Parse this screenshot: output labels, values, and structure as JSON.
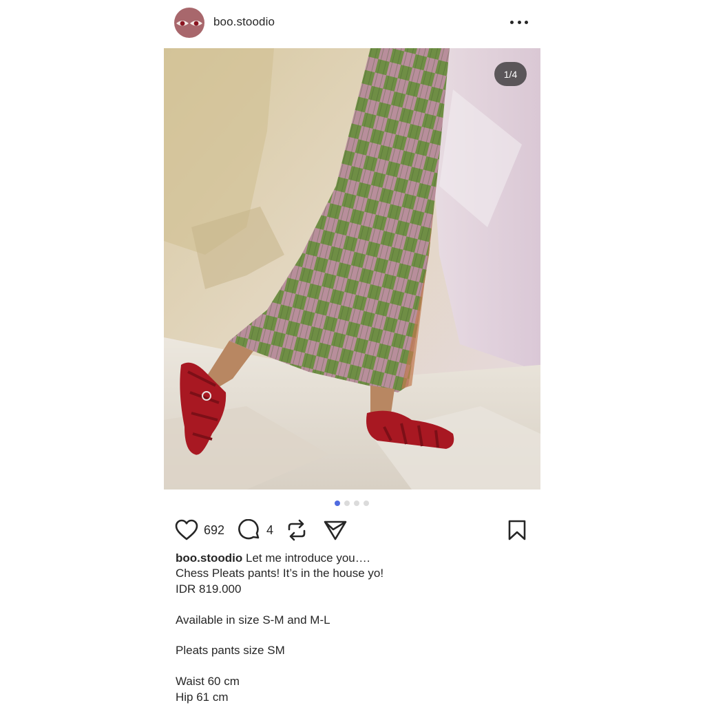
{
  "post": {
    "username": "boo.stoodio",
    "counter": "1/4",
    "carousel_count": 4,
    "carousel_active_index": 0,
    "likes": "692",
    "comments": "4"
  },
  "caption": {
    "username": "boo.stoodio",
    "first_line": "Let me introduce you….",
    "lines": [
      "Chess Pleats pants! It’s in the house yo!",
      "IDR 819.000",
      "",
      "Available in size S-M and M-L",
      "",
      "Pleats pants size SM",
      "",
      "Waist 60 cm",
      "Hip 61 cm"
    ]
  },
  "icons": {
    "more": "more-horizontal-icon",
    "like": "heart-icon",
    "comment": "comment-bubble-icon",
    "repost": "repost-icon",
    "share": "send-icon",
    "save": "bookmark-icon"
  },
  "colors": {
    "accent_dot": "#4f6be0",
    "text": "#262626",
    "avatar_bg": "#a8676c"
  }
}
